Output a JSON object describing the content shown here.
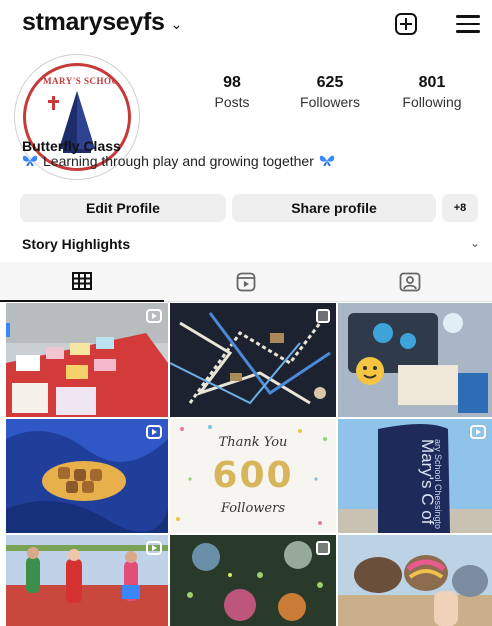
{
  "header": {
    "username": "stmaryseyfs",
    "chevron": "⌄",
    "add_icon": "plus-square-icon",
    "menu_icon": "hamburger-menu-icon"
  },
  "profile": {
    "avatar_text": "ST MARY'S SCHOOL",
    "stats": [
      {
        "value": "98",
        "label": "Posts"
      },
      {
        "value": "625",
        "label": "Followers"
      },
      {
        "value": "801",
        "label": "Following"
      }
    ],
    "bio_name": "Butterfly Class",
    "bio_text": "Learning through play and growing together"
  },
  "actions": {
    "edit_profile": "Edit Profile",
    "share_profile": "Share profile",
    "discover_people": "+8"
  },
  "highlights": {
    "label": "Story Highlights",
    "chevron": "⌄"
  },
  "tabs": [
    {
      "icon": "grid-icon",
      "active": true
    },
    {
      "icon": "reels-icon",
      "active": false
    },
    {
      "icon": "tagged-icon",
      "active": false
    }
  ],
  "posts": [
    {
      "badge": "reel"
    },
    {
      "badge": "multi"
    },
    {
      "badge": "none"
    },
    {
      "badge": "reel"
    },
    {
      "badge": "none"
    },
    {
      "badge": "reel"
    },
    {
      "badge": "reel"
    },
    {
      "badge": "multi"
    },
    {
      "badge": "none"
    }
  ],
  "thank_you_post": {
    "line1": "Thank You",
    "number": "600",
    "line2": "Followers"
  },
  "banner_post": {
    "text": "Mary's C of E",
    "subtext": "ary School Chessingto"
  },
  "colors": {
    "accent_blue": "#3a86ff",
    "button_bg": "#efefef",
    "school_red": "#c63a3a"
  }
}
